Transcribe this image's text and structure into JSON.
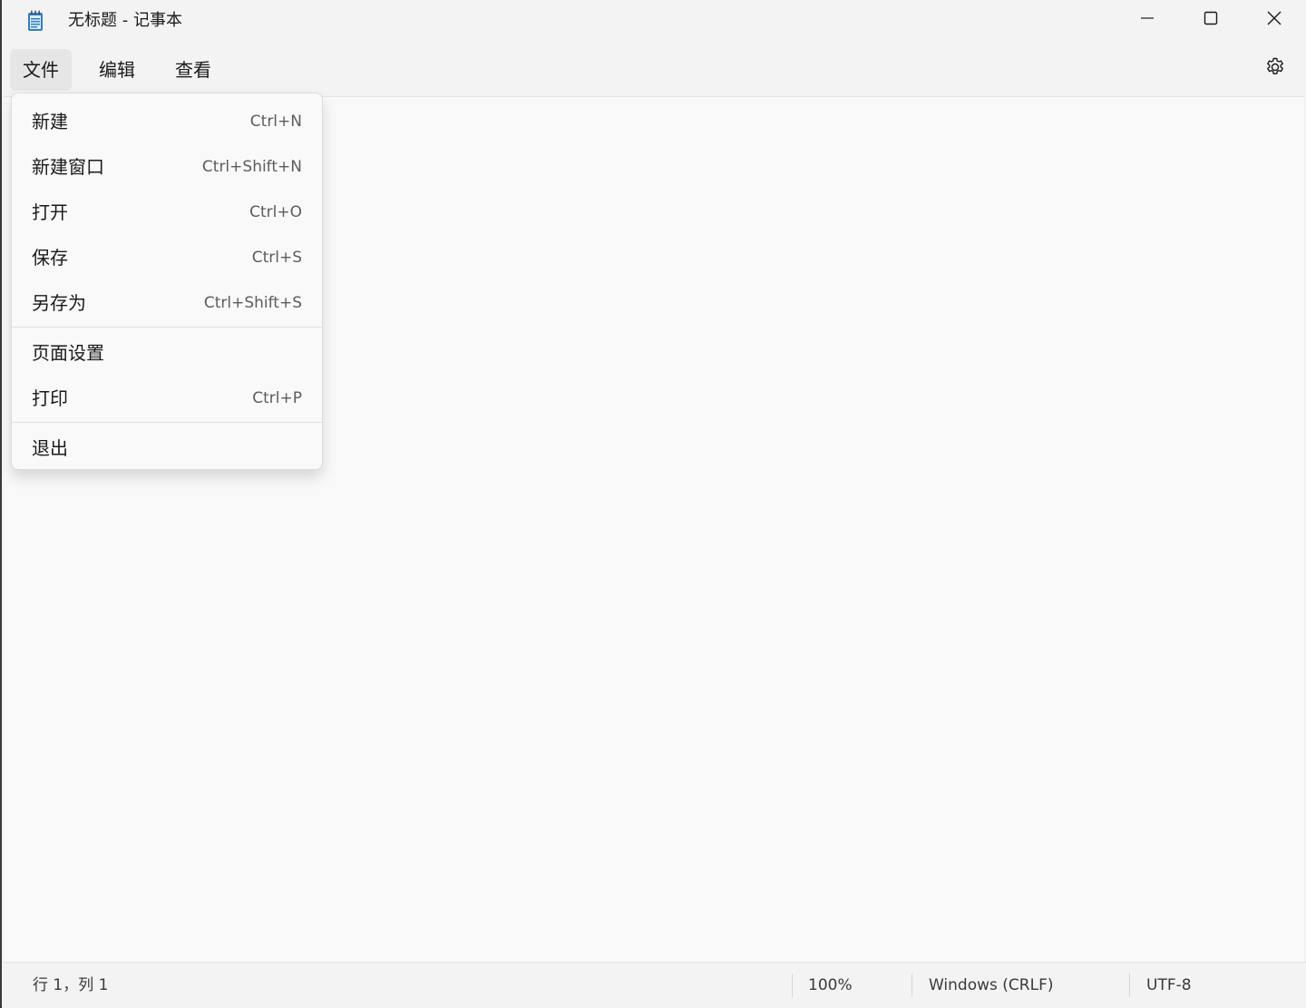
{
  "window": {
    "title": "无标题 - 记事本"
  },
  "menubar": {
    "items": [
      {
        "label": "文件",
        "active": true
      },
      {
        "label": "编辑",
        "active": false
      },
      {
        "label": "查看",
        "active": false
      }
    ]
  },
  "file_menu": {
    "items": [
      {
        "label": "新建",
        "shortcut": "Ctrl+N"
      },
      {
        "label": "新建窗口",
        "shortcut": "Ctrl+Shift+N"
      },
      {
        "label": "打开",
        "shortcut": "Ctrl+O"
      },
      {
        "label": "保存",
        "shortcut": "Ctrl+S"
      },
      {
        "label": "另存为",
        "shortcut": "Ctrl+Shift+S"
      },
      {
        "label": "页面设置",
        "shortcut": ""
      },
      {
        "label": "打印",
        "shortcut": "Ctrl+P"
      },
      {
        "label": "退出",
        "shortcut": ""
      }
    ]
  },
  "statusbar": {
    "position": "行 1，列 1",
    "zoom": "100%",
    "line_ending": "Windows (CRLF)",
    "encoding": "UTF-8"
  },
  "colors": {
    "titlebar_bg": "#f3f3f3",
    "editor_bg": "#f9f9f9",
    "menu_active_bg": "#e6e6e6",
    "icon_blue": "#2f7fc4"
  },
  "icons": {
    "app": "notepad-icon",
    "minimize": "minimize-icon",
    "maximize": "maximize-icon",
    "close": "close-icon",
    "settings": "gear-icon"
  }
}
